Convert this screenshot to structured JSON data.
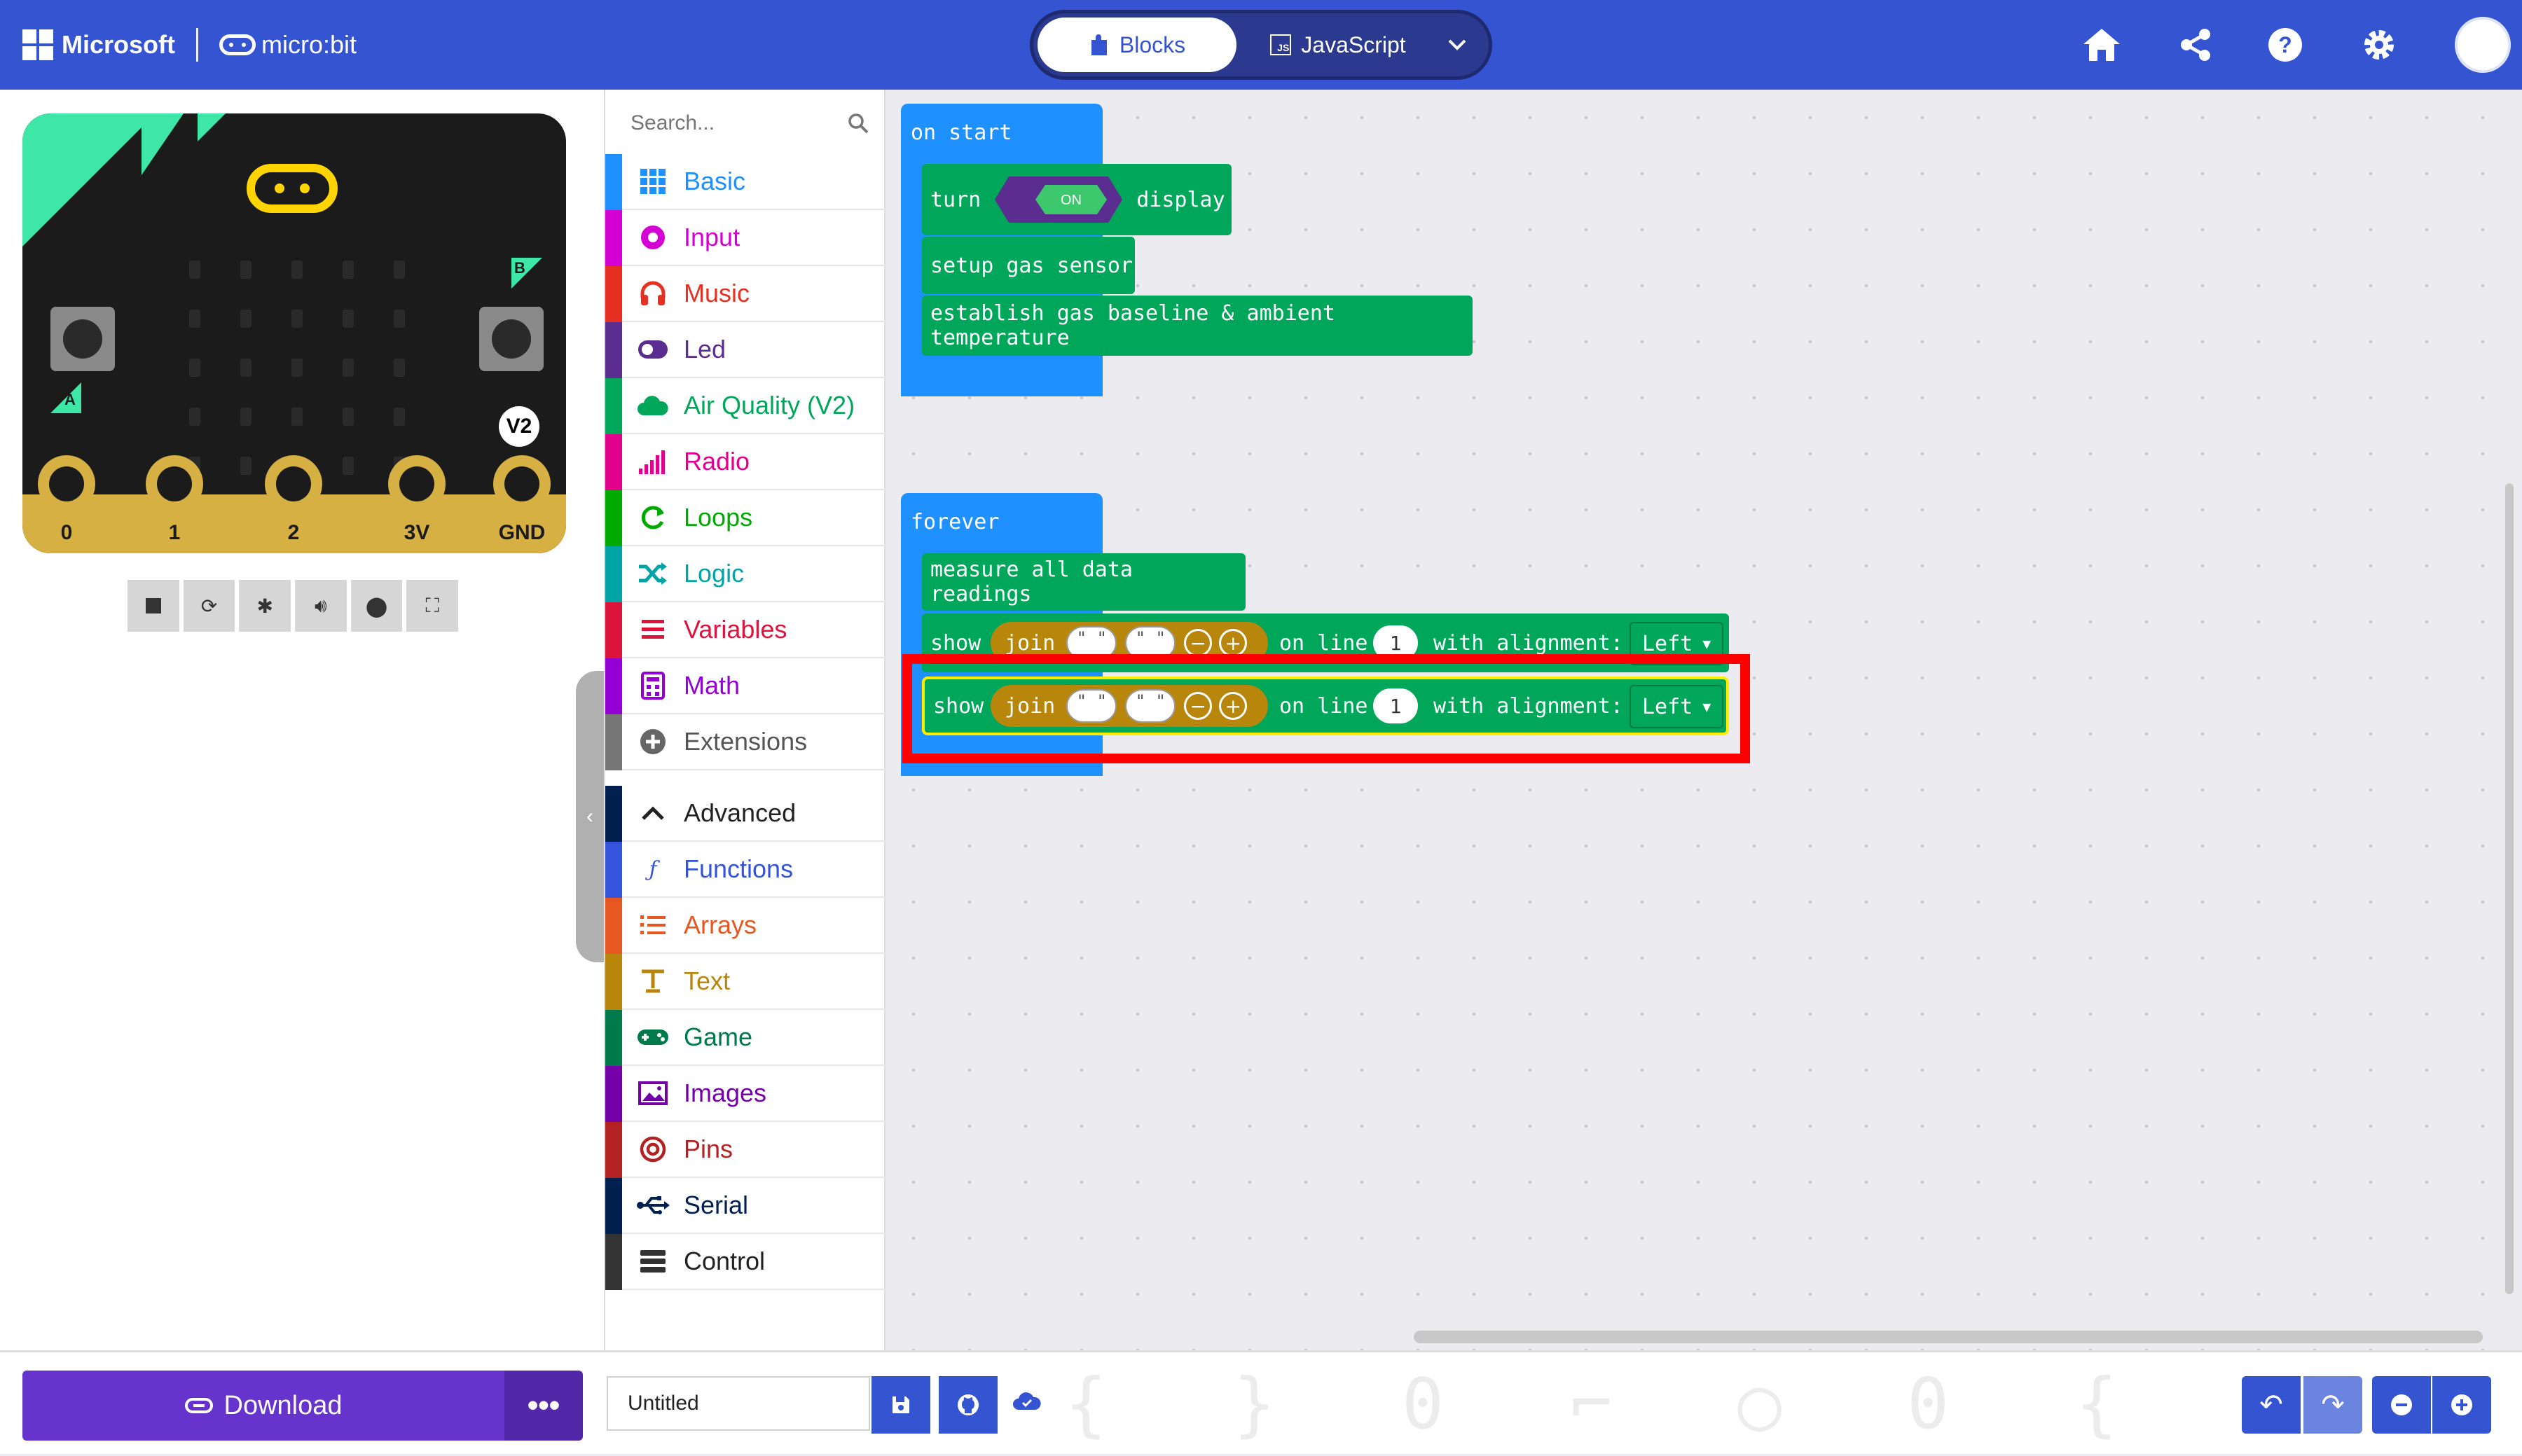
{
  "header": {
    "brand_ms": "Microsoft",
    "brand_mb": "micro:bit",
    "mode_blocks": "Blocks",
    "mode_js": "JavaScript",
    "js_badge": "JS",
    "accent": "#3454d1"
  },
  "simulator": {
    "pins": [
      "0",
      "1",
      "2",
      "3V",
      "GND"
    ],
    "label_a": "A",
    "label_b": "B",
    "version_badge": "V2",
    "toolbar": [
      "stop-icon",
      "restart-icon",
      "debug-icon",
      "sound-icon",
      "screenshot-icon",
      "fullscreen-icon"
    ]
  },
  "toolbox": {
    "search_placeholder": "Search...",
    "categories": [
      {
        "name": "Basic",
        "color": "#1e90ff"
      },
      {
        "name": "Input",
        "color": "#d400d4"
      },
      {
        "name": "Music",
        "color": "#e63022"
      },
      {
        "name": "Led",
        "color": "#5c2d91"
      },
      {
        "name": "Air Quality (V2)",
        "color": "#00a65a"
      },
      {
        "name": "Radio",
        "color": "#e3008c"
      },
      {
        "name": "Loops",
        "color": "#00aa00"
      },
      {
        "name": "Logic",
        "color": "#00a4a6"
      },
      {
        "name": "Variables",
        "color": "#dc143c"
      },
      {
        "name": "Math",
        "color": "#9400d3"
      },
      {
        "name": "Extensions",
        "color": "#777777"
      },
      {
        "name": "Advanced",
        "color": "#002050"
      },
      {
        "name": "Functions",
        "color": "#3455db"
      },
      {
        "name": "Arrays",
        "color": "#e65722"
      },
      {
        "name": "Text",
        "color": "#b8860b"
      },
      {
        "name": "Game",
        "color": "#007a4b"
      },
      {
        "name": "Images",
        "color": "#7600a8"
      },
      {
        "name": "Pins",
        "color": "#b22222"
      },
      {
        "name": "Serial",
        "color": "#002050"
      },
      {
        "name": "Control",
        "color": "#333333"
      }
    ]
  },
  "workspace": {
    "on_start": {
      "hat": "on start",
      "turn": "turn",
      "toggle": "ON",
      "display": "display",
      "setup": "setup gas sensor",
      "establish": "establish gas baseline & ambient temperature"
    },
    "forever": {
      "hat": "forever",
      "measure": "measure all data readings",
      "show_rows": [
        {
          "show": "show",
          "join": "join",
          "on_line": "on line",
          "line_value": "1",
          "with_alignment": "with alignment:",
          "alignment": "Left"
        },
        {
          "show": "show",
          "join": "join",
          "on_line": "on line",
          "line_value": "1",
          "with_alignment": "with alignment:",
          "alignment": "Left"
        }
      ]
    },
    "string_quote": "\" \"",
    "highlight_color": "#ff0000"
  },
  "footer": {
    "download": "Download",
    "project_name": "Untitled"
  }
}
